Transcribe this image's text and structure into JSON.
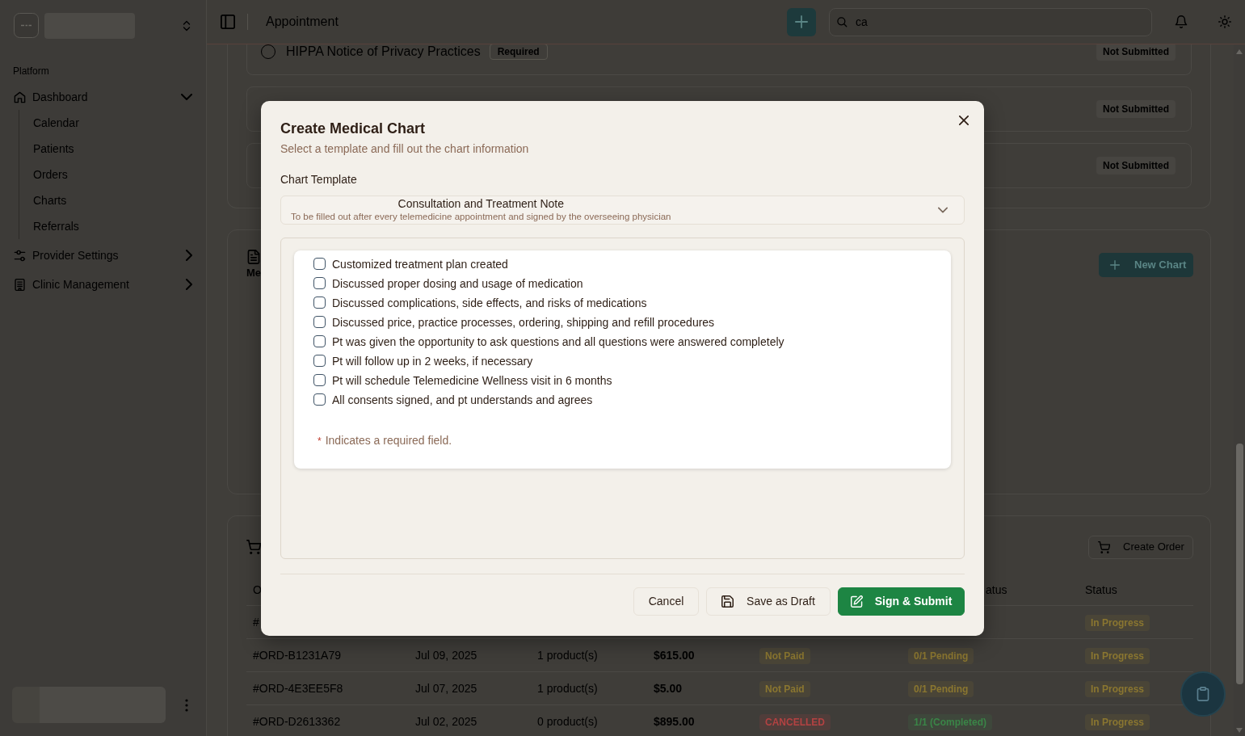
{
  "sidebar": {
    "section_label": "Platform",
    "items": [
      {
        "label": "Dashboard",
        "expanded": true,
        "children": [
          {
            "label": "Calendar"
          },
          {
            "label": "Patients"
          },
          {
            "label": "Orders"
          },
          {
            "label": "Charts"
          },
          {
            "label": "Referrals"
          }
        ]
      },
      {
        "label": "Provider Settings",
        "expanded": false
      },
      {
        "label": "Clinic Management",
        "expanded": false
      }
    ]
  },
  "topbar": {
    "title": "Appointment",
    "search": {
      "value": "ca"
    }
  },
  "documents": [
    {
      "checked": false,
      "title": "HIPPA Notice of Privacy Practices",
      "tag": "Required",
      "status": "Not Submitted"
    },
    {
      "status": "Not Submitted"
    },
    {
      "status": "Not Submitted"
    }
  ],
  "charts_card": {
    "title": "Me",
    "button": "New Chart"
  },
  "orders_card": {
    "button": "Create Order",
    "table": {
      "columns": {
        "column_1": "O",
        "column_6": "atus",
        "column_7": "Status"
      },
      "rows": [
        {
          "column_1": "#",
          "column_7": {
            "text": "In Progress",
            "color": "#8a7630"
          }
        },
        {
          "column_1": "#ORD-B1231A79",
          "column_2": "Jul 09, 2025",
          "column_3": "1 product(s)",
          "column_4": "$615.00",
          "column_5": {
            "text": "Not Paid",
            "color": "#8a7630"
          },
          "column_6": {
            "text": "0/1 Pending",
            "color": "#8a7630"
          },
          "column_7": {
            "text": "In Progress",
            "color": "#8a7630"
          }
        },
        {
          "column_1": "#ORD-4E3EE5F8",
          "column_2": "Jul 07, 2025",
          "column_3": "1 product(s)",
          "column_4": "$5.00",
          "column_5": {
            "text": "Not Paid",
            "color": "#8a7630"
          },
          "column_6": {
            "text": "0/1 Pending",
            "color": "#8a7630"
          },
          "column_7": {
            "text": "In Progress",
            "color": "#8a7630"
          }
        },
        {
          "column_1": "#ORD-D2613362",
          "column_2": "Jul 02, 2025",
          "column_3": "0 product(s)",
          "column_4": "$895.00",
          "column_5": {
            "text": "CANCELLED",
            "color": "#b34242"
          },
          "column_6": {
            "text": "1/1 (Completed)",
            "color": "#3a8547"
          },
          "column_7": {
            "text": "In Progress",
            "color": "#8a7630"
          }
        }
      ]
    }
  },
  "dialog": {
    "title": "Create Medical Chart",
    "subtitle": "Select a template and fill out the chart information",
    "template_label": "Chart Template",
    "template": {
      "name": "Consultation and Treatment Note",
      "description": "To be filled out after every telemedicine appointment and signed by the overseeing physician"
    },
    "checklist": [
      {
        "label": "Customized treatment plan created",
        "checked": false
      },
      {
        "label": "Discussed proper dosing and usage of medication",
        "checked": false
      },
      {
        "label": "Discussed complications, side effects, and risks of medications",
        "checked": false
      },
      {
        "label": "Discussed price, practice processes, ordering, shipping and refill procedures",
        "checked": false
      },
      {
        "label": "Pt was given the opportunity to ask questions and all questions were answered completely",
        "checked": false
      },
      {
        "label": "Pt will follow up in 2 weeks, if necessary",
        "checked": false
      },
      {
        "label": "Pt will schedule Telemedicine Wellness visit in 6 months",
        "checked": false
      },
      {
        "label": "All consents signed, and pt understands and agrees",
        "checked": false
      }
    ],
    "required_note": {
      "mark": "*",
      "text": "Indicates a required field."
    },
    "buttons": [
      {
        "label": "Cancel",
        "kind": "cancel"
      },
      {
        "label": "Save as Draft",
        "kind": "draft"
      },
      {
        "label": "Sign & Submit",
        "kind": "submit"
      }
    ]
  }
}
